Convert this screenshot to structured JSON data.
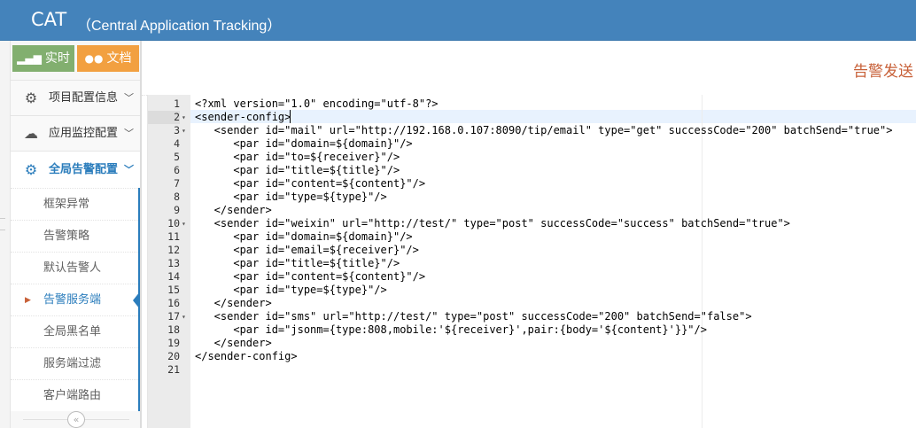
{
  "header": {
    "brand": "CAT",
    "subtitle": "（Central Application Tracking）"
  },
  "shortcuts": [
    {
      "label": "实时",
      "icon": "signal-icon",
      "color": "#82af6f"
    },
    {
      "label": "文档",
      "icon": "users-icon",
      "color": "#f2a040"
    }
  ],
  "nav": {
    "project_config": "项目配置信息",
    "app_monitor": "应用监控配置",
    "global_alert": "全局告警配置",
    "sub_items": [
      "框架异常",
      "告警策略",
      "默认告警人",
      "告警服务端",
      "全局黑名单",
      "服务端过滤",
      "客户端路由"
    ]
  },
  "collapse_glyph": "«",
  "page_title": "告警发送",
  "editor": {
    "lines": [
      {
        "n": "1",
        "fold": "",
        "text": "<?xml version=\"1.0\" encoding=\"utf-8\"?>"
      },
      {
        "n": "2",
        "fold": "▾",
        "text": "<sender-config>"
      },
      {
        "n": "3",
        "fold": "▾",
        "text": "   <sender id=\"mail\" url=\"http://192.168.0.107:8090/tip/email\" type=\"get\" successCode=\"200\" batchSend=\"true\">"
      },
      {
        "n": "4",
        "fold": "",
        "text": "      <par id=\"domain=${domain}\"/>"
      },
      {
        "n": "5",
        "fold": "",
        "text": "      <par id=\"to=${receiver}\"/>"
      },
      {
        "n": "6",
        "fold": "",
        "text": "      <par id=\"title=${title}\"/>"
      },
      {
        "n": "7",
        "fold": "",
        "text": "      <par id=\"content=${content}\"/>"
      },
      {
        "n": "8",
        "fold": "",
        "text": "      <par id=\"type=${type}\"/>"
      },
      {
        "n": "9",
        "fold": "",
        "text": "   </sender>"
      },
      {
        "n": "10",
        "fold": "▾",
        "text": "   <sender id=\"weixin\" url=\"http://test/\" type=\"post\" successCode=\"success\" batchSend=\"true\">"
      },
      {
        "n": "11",
        "fold": "",
        "text": "      <par id=\"domain=${domain}\"/>"
      },
      {
        "n": "12",
        "fold": "",
        "text": "      <par id=\"email=${receiver}\"/>"
      },
      {
        "n": "13",
        "fold": "",
        "text": "      <par id=\"title=${title}\"/>"
      },
      {
        "n": "14",
        "fold": "",
        "text": "      <par id=\"content=${content}\"/>"
      },
      {
        "n": "15",
        "fold": "",
        "text": "      <par id=\"type=${type}\"/>"
      },
      {
        "n": "16",
        "fold": "",
        "text": "   </sender>"
      },
      {
        "n": "17",
        "fold": "▾",
        "text": "   <sender id=\"sms\" url=\"http://test/\" type=\"post\" successCode=\"200\" batchSend=\"false\">"
      },
      {
        "n": "18",
        "fold": "",
        "text": "      <par id=\"jsonm={type:808,mobile:'${receiver}',pair:{body='${content}'}}\"/>"
      },
      {
        "n": "19",
        "fold": "",
        "text": "   </sender>"
      },
      {
        "n": "20",
        "fold": "",
        "text": "</sender-config>"
      },
      {
        "n": "21",
        "fold": "",
        "text": ""
      }
    ]
  }
}
